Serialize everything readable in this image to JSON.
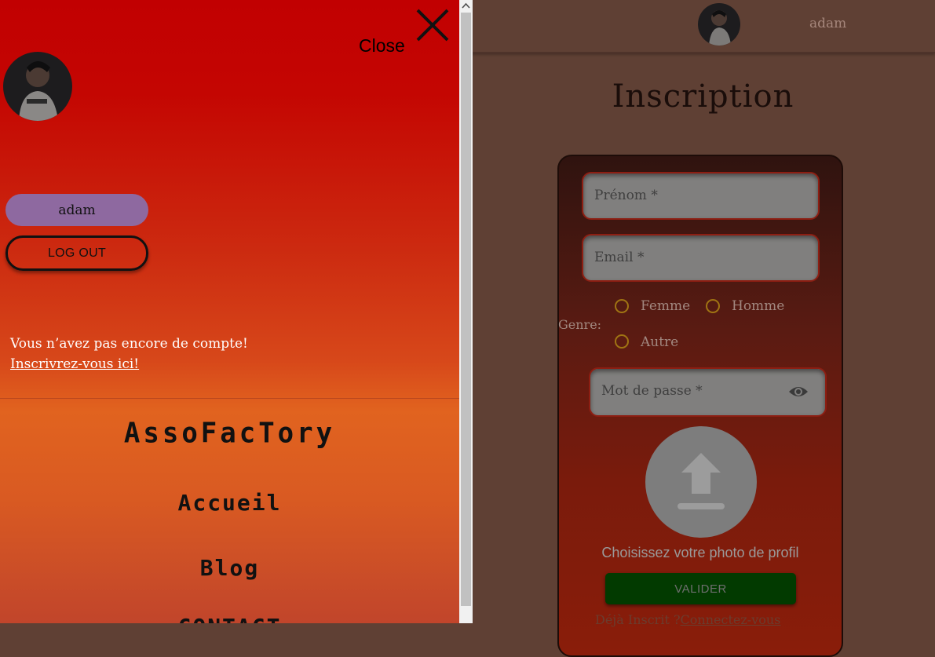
{
  "drawer": {
    "close_label": "Close",
    "username": "adam",
    "logout_label": "LOG OUT",
    "no_account_text": "Vous n’avez pas encore de compte!",
    "signup_link": "Inscrivrez-vous ici!",
    "brand": "AssoFacTory",
    "nav": [
      "Accueil",
      "Blog",
      "CONTACT"
    ]
  },
  "header": {
    "username": "adam"
  },
  "form": {
    "title": "Inscription",
    "firstname_placeholder": "Prénom *",
    "email_placeholder": "Email *",
    "genre_label": "Genre:",
    "genre_options": [
      "Femme",
      "Homme",
      "Autre"
    ],
    "password_placeholder": "Mot de passe *",
    "photo_label": "Choisissez votre photo de profil",
    "submit_label": "VALIDER",
    "already_registered": "Déjà Inscrit ?",
    "login_link": "Connectez-vous"
  },
  "colors": {
    "drawer_top": "#c10001",
    "drawer_mid": "#e1631f",
    "overlay_bg": "#5f4034",
    "user_pill": "#8e69a0",
    "submit_bg": "#023a00"
  }
}
